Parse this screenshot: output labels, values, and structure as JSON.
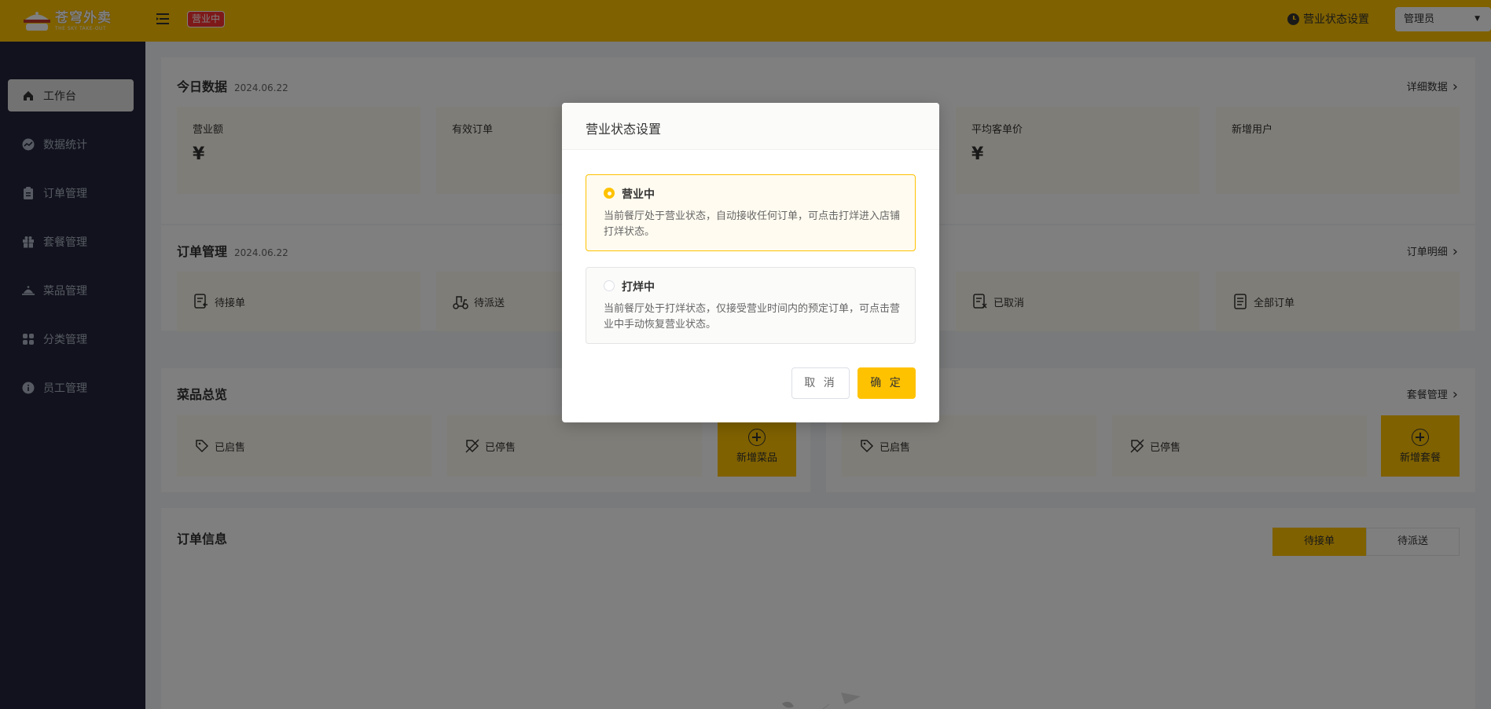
{
  "header": {
    "logo_cn": "苍穹外卖",
    "logo_en": "THE SKY TAKE-OUT",
    "status_tag": "营业中",
    "status_setting": "营业状态设置",
    "user": "管理员",
    "accent": "#ffc200"
  },
  "sidebar": {
    "items": [
      {
        "label": "工作台",
        "icon": "home-icon"
      },
      {
        "label": "数据统计",
        "icon": "chart-icon"
      },
      {
        "label": "订单管理",
        "icon": "clipboard-icon"
      },
      {
        "label": "套餐管理",
        "icon": "gift-icon"
      },
      {
        "label": "菜品管理",
        "icon": "cloche-icon"
      },
      {
        "label": "分类管理",
        "icon": "grid-icon"
      },
      {
        "label": "员工管理",
        "icon": "info-icon"
      }
    ]
  },
  "today": {
    "title": "今日数据",
    "date": "2024.06.22",
    "link": "详细数据",
    "stats": [
      {
        "label": "营业额",
        "value": "¥"
      },
      {
        "label": "有效订单",
        "value": ""
      },
      {
        "label": "",
        "value": ""
      },
      {
        "label": "平均客单价",
        "value": "¥"
      },
      {
        "label": "新增用户",
        "value": ""
      }
    ]
  },
  "orders": {
    "title": "订单管理",
    "date": "2024.06.22",
    "link": "订单明细",
    "items": [
      "待接单",
      "待派送",
      "",
      "已取消",
      "全部订单"
    ]
  },
  "dishes": {
    "title": "菜品总览",
    "link": "套餐管理",
    "dish_on": "已启售",
    "dish_off": "已停售",
    "add_dish": "新增菜品",
    "combo_on": "已启售",
    "combo_off": "已停售",
    "add_combo": "新增套餐"
  },
  "order_info": {
    "title": "订单信息",
    "tabs": [
      "待接单",
      "待派送"
    ]
  },
  "modal": {
    "title": "营业状态设置",
    "options": [
      {
        "title": "营业中",
        "desc": "当前餐厅处于营业状态，自动接收任何订单，可点击打烊进入店铺打烊状态。",
        "selected": true
      },
      {
        "title": "打烊中",
        "desc": "当前餐厅处于打烊状态，仅接受营业时间内的预定订单，可点击营业中手动恢复营业状态。",
        "selected": false
      }
    ],
    "cancel": "取 消",
    "confirm": "确 定"
  }
}
